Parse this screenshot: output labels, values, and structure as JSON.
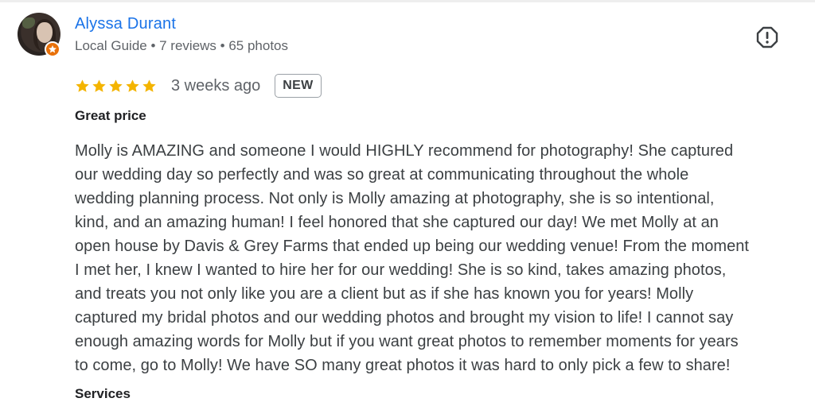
{
  "reviewer": {
    "name": "Alyssa Durant",
    "meta": "Local Guide • 7 reviews • 65 photos",
    "avatar_icon": "user-photo",
    "badge_icon": "local-guide-star-icon",
    "badge_color": "#e8710a"
  },
  "review": {
    "rating": 5,
    "rating_max": 5,
    "star_color": "#f4b400",
    "date": "3 weeks ago",
    "badge": "NEW",
    "title": "Great price",
    "lines": [
      "Molly is AMAZING and someone I would HIGHLY recommend for photography! She captured",
      "our wedding day so perfectly and was so great at communicating throughout the whole",
      "wedding planning process. Not only is Molly amazing at photography, she is so intentional,",
      "kind, and an amazing human! I feel honored that she captured our day! We met Molly at an",
      "open house by Davis & Grey Farms that ended up being our wedding venue! From the moment",
      "I met her, I knew I wanted to hire her for our wedding! She is so kind, takes amazing photos,",
      "and treats you not only like you are a client but as if she has known you for years! Molly",
      "captured my bridal photos and our wedding photos and brought my vision to life! I cannot say",
      "enough amazing words for Molly but if you want great photos to remember moments for years",
      "to come, go to Molly! We have SO many great photos it was hard to only pick a few to share!"
    ],
    "next_label": "Services"
  },
  "actions": {
    "report_icon": "report-icon"
  },
  "colors": {
    "name_link": "#1a73e8",
    "secondary_text": "#5f6368",
    "body_text": "#3c4043"
  }
}
